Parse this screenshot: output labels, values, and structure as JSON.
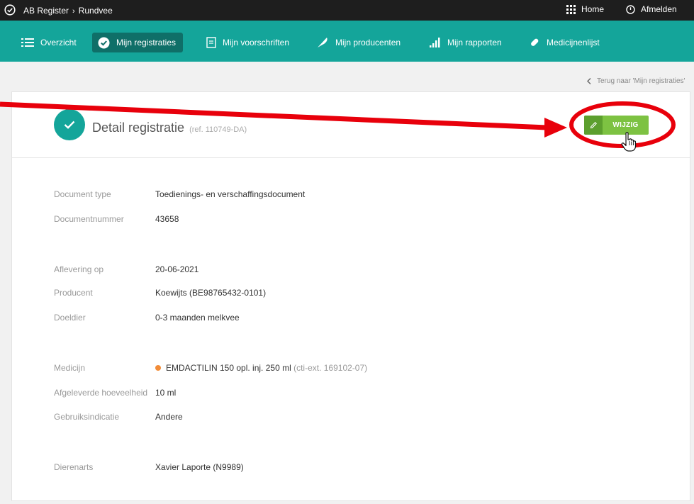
{
  "topbar": {
    "app": "AB Register",
    "separator": "›",
    "section": "Rundvee",
    "home": "Home",
    "logout": "Afmelden"
  },
  "nav": [
    {
      "label": "Overzicht",
      "icon": "list-icon"
    },
    {
      "label": "Mijn registraties",
      "icon": "check-circle-icon",
      "active": true
    },
    {
      "label": "Mijn voorschriften",
      "icon": "document-icon"
    },
    {
      "label": "Mijn producenten",
      "icon": "feather-icon"
    },
    {
      "label": "Mijn rapporten",
      "icon": "bar-chart-icon"
    },
    {
      "label": "Medicijnenlijst",
      "icon": "pill-icon"
    }
  ],
  "back_link": "Terug naar 'Mijn registraties'",
  "detail": {
    "title": "Detail registratie",
    "ref": "(ref. 110749-DA)",
    "edit_button": "WIJZIG"
  },
  "fields": {
    "document_type": {
      "label": "Document type",
      "value": "Toedienings- en verschaffingsdocument"
    },
    "document_number": {
      "label": "Documentnummer",
      "value": "43658"
    },
    "delivery_date": {
      "label": "Aflevering op",
      "value": "20-06-2021"
    },
    "producer": {
      "label": "Producent",
      "value": "Koewijts (BE98765432-0101)"
    },
    "target_animal": {
      "label": "Doeldier",
      "value": "0-3 maanden melkvee"
    },
    "medicine": {
      "label": "Medicijn",
      "value": "EMDACTILIN 150 opl. inj. 250 ml",
      "ext": "(cti-ext. 169102-07)",
      "status_color": "#f28c38"
    },
    "quantity": {
      "label": "Afgeleverde hoeveelheid",
      "value": "10 ml"
    },
    "indication": {
      "label": "Gebruiksindicatie",
      "value": "Andere"
    },
    "veterinarian": {
      "label": "Dierenarts",
      "value": "Xavier Laporte (N9989)"
    }
  },
  "colors": {
    "nav_bg": "#14a59a",
    "nav_active": "#0f6f68",
    "edit_button": "#7dc242",
    "annotation": "#e8000b"
  }
}
